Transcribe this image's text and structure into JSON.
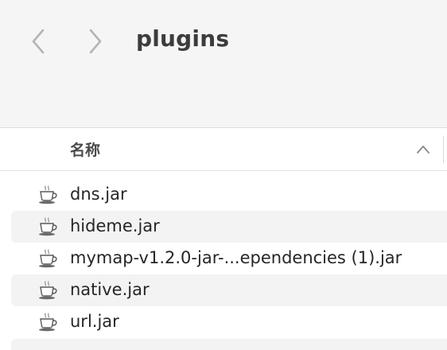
{
  "window": {
    "title": "plugins",
    "back_icon": "chevron-left-icon",
    "forward_icon": "chevron-right-icon"
  },
  "columns": {
    "name_header": "名称",
    "sort_icon": "chevron-up-icon"
  },
  "files": [
    {
      "name": "dns.jar",
      "icon": "java-jar-icon"
    },
    {
      "name": "hideme.jar",
      "icon": "java-jar-icon"
    },
    {
      "name": "mymap-v1.2.0-jar-...ependencies (1).jar",
      "icon": "java-jar-icon"
    },
    {
      "name": "native.jar",
      "icon": "java-jar-icon"
    },
    {
      "name": "url.jar",
      "icon": "java-jar-icon"
    }
  ],
  "colors": {
    "toolbar_bg": "#f5f5f5",
    "row_alt_bg": "#f3f3f3",
    "text": "#262626"
  }
}
